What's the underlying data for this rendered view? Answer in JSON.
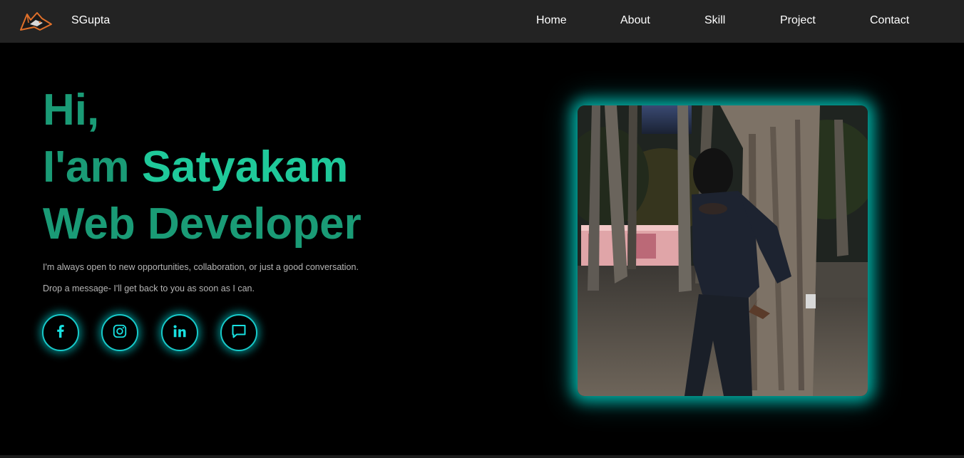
{
  "header": {
    "brand": "SGupta",
    "logo_icon": "fox-logo-icon",
    "nav": [
      {
        "label": "Home"
      },
      {
        "label": "About"
      },
      {
        "label": "Skill"
      },
      {
        "label": "Project"
      },
      {
        "label": "Contact"
      }
    ]
  },
  "hero": {
    "greeting": "Hi,",
    "intro_prefix": "I'am",
    "name": "Satyakam",
    "role": "Web Developer",
    "message_line1": "I'm always open to new opportunities, collaboration, or just a good conversation.",
    "message_line2": "Drop a message- I'll get back to you as soon as I can."
  },
  "social": [
    {
      "icon": "facebook-icon"
    },
    {
      "icon": "instagram-icon"
    },
    {
      "icon": "linkedin-icon"
    },
    {
      "icon": "message-icon"
    }
  ],
  "colors": {
    "accent_dark": "#1a9b76",
    "accent_light": "#1fc99a",
    "glow": "#18c9c9",
    "navbar_bg": "#232323",
    "page_bg": "#000000"
  }
}
